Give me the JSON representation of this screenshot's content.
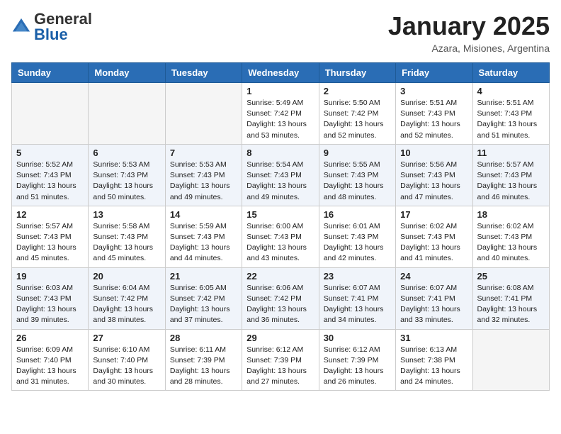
{
  "header": {
    "logo_general": "General",
    "logo_blue": "Blue",
    "month": "January 2025",
    "location": "Azara, Misiones, Argentina"
  },
  "days_of_week": [
    "Sunday",
    "Monday",
    "Tuesday",
    "Wednesday",
    "Thursday",
    "Friday",
    "Saturday"
  ],
  "weeks": [
    [
      {
        "day": "",
        "info": ""
      },
      {
        "day": "",
        "info": ""
      },
      {
        "day": "",
        "info": ""
      },
      {
        "day": "1",
        "info": "Sunrise: 5:49 AM\nSunset: 7:42 PM\nDaylight: 13 hours\nand 53 minutes."
      },
      {
        "day": "2",
        "info": "Sunrise: 5:50 AM\nSunset: 7:42 PM\nDaylight: 13 hours\nand 52 minutes."
      },
      {
        "day": "3",
        "info": "Sunrise: 5:51 AM\nSunset: 7:43 PM\nDaylight: 13 hours\nand 52 minutes."
      },
      {
        "day": "4",
        "info": "Sunrise: 5:51 AM\nSunset: 7:43 PM\nDaylight: 13 hours\nand 51 minutes."
      }
    ],
    [
      {
        "day": "5",
        "info": "Sunrise: 5:52 AM\nSunset: 7:43 PM\nDaylight: 13 hours\nand 51 minutes."
      },
      {
        "day": "6",
        "info": "Sunrise: 5:53 AM\nSunset: 7:43 PM\nDaylight: 13 hours\nand 50 minutes."
      },
      {
        "day": "7",
        "info": "Sunrise: 5:53 AM\nSunset: 7:43 PM\nDaylight: 13 hours\nand 49 minutes."
      },
      {
        "day": "8",
        "info": "Sunrise: 5:54 AM\nSunset: 7:43 PM\nDaylight: 13 hours\nand 49 minutes."
      },
      {
        "day": "9",
        "info": "Sunrise: 5:55 AM\nSunset: 7:43 PM\nDaylight: 13 hours\nand 48 minutes."
      },
      {
        "day": "10",
        "info": "Sunrise: 5:56 AM\nSunset: 7:43 PM\nDaylight: 13 hours\nand 47 minutes."
      },
      {
        "day": "11",
        "info": "Sunrise: 5:57 AM\nSunset: 7:43 PM\nDaylight: 13 hours\nand 46 minutes."
      }
    ],
    [
      {
        "day": "12",
        "info": "Sunrise: 5:57 AM\nSunset: 7:43 PM\nDaylight: 13 hours\nand 45 minutes."
      },
      {
        "day": "13",
        "info": "Sunrise: 5:58 AM\nSunset: 7:43 PM\nDaylight: 13 hours\nand 45 minutes."
      },
      {
        "day": "14",
        "info": "Sunrise: 5:59 AM\nSunset: 7:43 PM\nDaylight: 13 hours\nand 44 minutes."
      },
      {
        "day": "15",
        "info": "Sunrise: 6:00 AM\nSunset: 7:43 PM\nDaylight: 13 hours\nand 43 minutes."
      },
      {
        "day": "16",
        "info": "Sunrise: 6:01 AM\nSunset: 7:43 PM\nDaylight: 13 hours\nand 42 minutes."
      },
      {
        "day": "17",
        "info": "Sunrise: 6:02 AM\nSunset: 7:43 PM\nDaylight: 13 hours\nand 41 minutes."
      },
      {
        "day": "18",
        "info": "Sunrise: 6:02 AM\nSunset: 7:43 PM\nDaylight: 13 hours\nand 40 minutes."
      }
    ],
    [
      {
        "day": "19",
        "info": "Sunrise: 6:03 AM\nSunset: 7:43 PM\nDaylight: 13 hours\nand 39 minutes."
      },
      {
        "day": "20",
        "info": "Sunrise: 6:04 AM\nSunset: 7:42 PM\nDaylight: 13 hours\nand 38 minutes."
      },
      {
        "day": "21",
        "info": "Sunrise: 6:05 AM\nSunset: 7:42 PM\nDaylight: 13 hours\nand 37 minutes."
      },
      {
        "day": "22",
        "info": "Sunrise: 6:06 AM\nSunset: 7:42 PM\nDaylight: 13 hours\nand 36 minutes."
      },
      {
        "day": "23",
        "info": "Sunrise: 6:07 AM\nSunset: 7:41 PM\nDaylight: 13 hours\nand 34 minutes."
      },
      {
        "day": "24",
        "info": "Sunrise: 6:07 AM\nSunset: 7:41 PM\nDaylight: 13 hours\nand 33 minutes."
      },
      {
        "day": "25",
        "info": "Sunrise: 6:08 AM\nSunset: 7:41 PM\nDaylight: 13 hours\nand 32 minutes."
      }
    ],
    [
      {
        "day": "26",
        "info": "Sunrise: 6:09 AM\nSunset: 7:40 PM\nDaylight: 13 hours\nand 31 minutes."
      },
      {
        "day": "27",
        "info": "Sunrise: 6:10 AM\nSunset: 7:40 PM\nDaylight: 13 hours\nand 30 minutes."
      },
      {
        "day": "28",
        "info": "Sunrise: 6:11 AM\nSunset: 7:39 PM\nDaylight: 13 hours\nand 28 minutes."
      },
      {
        "day": "29",
        "info": "Sunrise: 6:12 AM\nSunset: 7:39 PM\nDaylight: 13 hours\nand 27 minutes."
      },
      {
        "day": "30",
        "info": "Sunrise: 6:12 AM\nSunset: 7:39 PM\nDaylight: 13 hours\nand 26 minutes."
      },
      {
        "day": "31",
        "info": "Sunrise: 6:13 AM\nSunset: 7:38 PM\nDaylight: 13 hours\nand 24 minutes."
      },
      {
        "day": "",
        "info": ""
      }
    ]
  ]
}
